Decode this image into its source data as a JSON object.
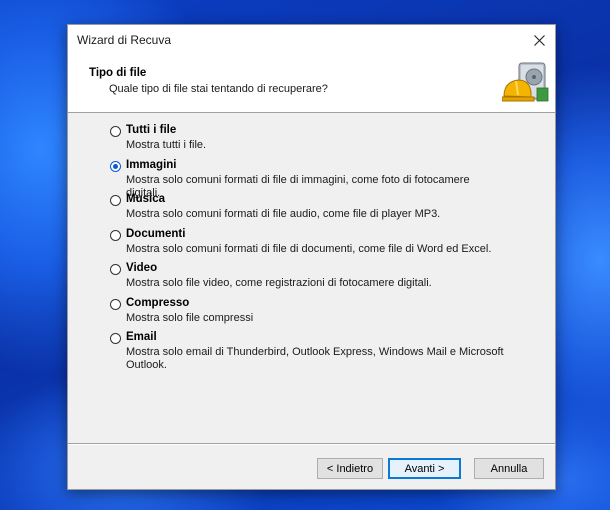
{
  "window": {
    "title": "Wizard di Recuva",
    "close_icon": "close-icon"
  },
  "header": {
    "title": "Tipo di file",
    "subtitle": "Quale tipo di file stai tentando di recuperare?",
    "icon": "hard-drive-hardhat-icon"
  },
  "options": [
    {
      "label": "Tutti i file",
      "description": "Mostra tutti i file.",
      "selected": false
    },
    {
      "label": "Immagini",
      "description": "Mostra solo comuni formati di file di immagini, come foto di fotocamere digitali.",
      "selected": true
    },
    {
      "label": "Musica",
      "description": "Mostra solo comuni formati di file audio, come file di player MP3.",
      "selected": false
    },
    {
      "label": "Documenti",
      "description": "Mostra solo comuni formati di file di documenti, come file di Word ed Excel.",
      "selected": false
    },
    {
      "label": "Video",
      "description": "Mostra solo file video, come registrazioni di fotocamere digitali.",
      "selected": false
    },
    {
      "label": "Compresso",
      "description": "Mostra solo file compressi",
      "selected": false
    },
    {
      "label": "Email",
      "description": "Mostra solo email di Thunderbird, Outlook Express, Windows Mail e Microsoft Outlook.",
      "selected": false
    }
  ],
  "buttons": {
    "back": "< Indietro",
    "next": "Avanti >",
    "cancel": "Annulla"
  },
  "colors": {
    "accent": "#0a5bd8",
    "desktop": "#0b3fc4"
  }
}
